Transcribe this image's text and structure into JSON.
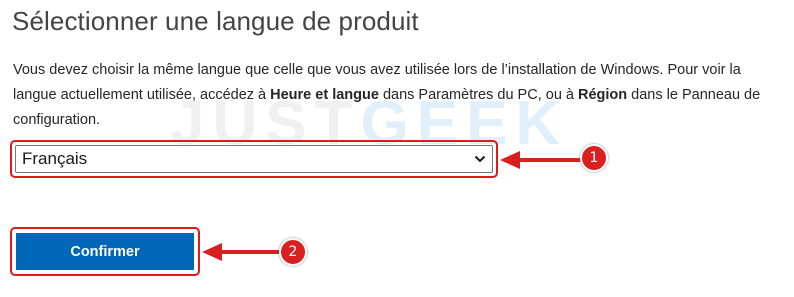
{
  "page": {
    "title": "Sélectionner une langue de produit",
    "description": {
      "part1": "Vous devez choisir la même langue que celle que vous avez utilisée lors de l’installation de Windows. Pour voir la langue actuellement utilisée, accédez à ",
      "bold1": "Heure et langue",
      "part2": " dans Paramètres du PC, ou à ",
      "bold2": "Région",
      "part3": " dans le Panneau de configuration."
    }
  },
  "language_select": {
    "selected_value": "Français",
    "icon": "chevron-down-icon"
  },
  "confirm_button": {
    "label": "Confirmer",
    "color": "#0067b8"
  },
  "annotations": {
    "step1": "1",
    "step2": "2",
    "color": "#d9201f"
  },
  "watermark": {
    "part1": "JUST",
    "part2": "GEEK"
  }
}
